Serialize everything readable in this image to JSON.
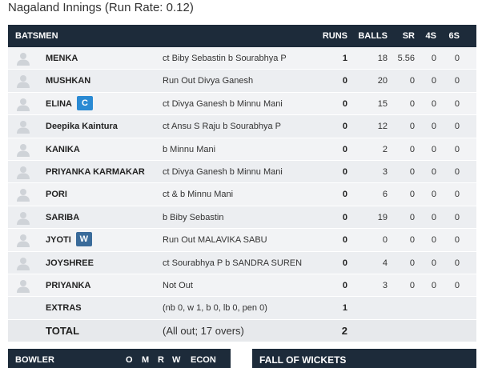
{
  "innings_title": "Nagaland Innings (Run Rate: 0.12)",
  "batting_header": {
    "batsmen": "BATSMEN",
    "runs": "RUNS",
    "balls": "BALLS",
    "sr": "SR",
    "fours": "4S",
    "sixes": "6S"
  },
  "batsmen": [
    {
      "name": "MENKA",
      "badge": "",
      "dismissal": "ct Biby Sebastin b Sourabhya P",
      "runs": "1",
      "balls": "18",
      "sr": "5.56",
      "fours": "0",
      "sixes": "0"
    },
    {
      "name": "MUSHKAN",
      "badge": "",
      "dismissal": "Run Out Divya Ganesh",
      "runs": "0",
      "balls": "20",
      "sr": "0",
      "fours": "0",
      "sixes": "0"
    },
    {
      "name": "ELINA",
      "badge": "C",
      "dismissal": "ct Divya Ganesh b Minnu Mani",
      "runs": "0",
      "balls": "15",
      "sr": "0",
      "fours": "0",
      "sixes": "0"
    },
    {
      "name": "Deepika Kaintura",
      "badge": "",
      "dismissal": "ct Ansu S Raju b Sourabhya P",
      "runs": "0",
      "balls": "12",
      "sr": "0",
      "fours": "0",
      "sixes": "0"
    },
    {
      "name": "KANIKA",
      "badge": "",
      "dismissal": "b Minnu Mani",
      "runs": "0",
      "balls": "2",
      "sr": "0",
      "fours": "0",
      "sixes": "0"
    },
    {
      "name": "PRIYANKA KARMAKAR",
      "badge": "",
      "dismissal": "ct Divya Ganesh b Minnu Mani",
      "runs": "0",
      "balls": "3",
      "sr": "0",
      "fours": "0",
      "sixes": "0"
    },
    {
      "name": "PORI",
      "badge": "",
      "dismissal": "ct & b Minnu Mani",
      "runs": "0",
      "balls": "6",
      "sr": "0",
      "fours": "0",
      "sixes": "0"
    },
    {
      "name": "SARIBA",
      "badge": "",
      "dismissal": "b Biby Sebastin",
      "runs": "0",
      "balls": "19",
      "sr": "0",
      "fours": "0",
      "sixes": "0"
    },
    {
      "name": "JYOTI",
      "badge": "W",
      "dismissal": "Run Out MALAVIKA SABU",
      "runs": "0",
      "balls": "0",
      "sr": "0",
      "fours": "0",
      "sixes": "0"
    },
    {
      "name": "JOYSHREE",
      "badge": "",
      "dismissal": "ct Sourabhya P b SANDRA SUREN",
      "runs": "0",
      "balls": "4",
      "sr": "0",
      "fours": "0",
      "sixes": "0"
    },
    {
      "name": "PRIYANKA",
      "badge": "",
      "dismissal": "Not Out",
      "runs": "0",
      "balls": "3",
      "sr": "0",
      "fours": "0",
      "sixes": "0"
    }
  ],
  "extras": {
    "label": "EXTRAS",
    "detail": "(nb 0, w 1, b 0, lb 0, pen 0)",
    "runs": "1"
  },
  "total": {
    "label": "TOTAL",
    "detail": "(All out; 17 overs)",
    "runs": "2"
  },
  "bowling_header": {
    "bowler": "BOWLER",
    "overs": "O",
    "maidens": "M",
    "runs": "R",
    "wickets": "W",
    "econ": "ECON"
  },
  "fow_header": "FALL OF WICKETS",
  "colors": {
    "header_bg": "#1d2b3a",
    "captain_badge": "#2a8ad3",
    "keeper_badge": "#3a6b9a",
    "row_bg": "#f2f3f5"
  }
}
